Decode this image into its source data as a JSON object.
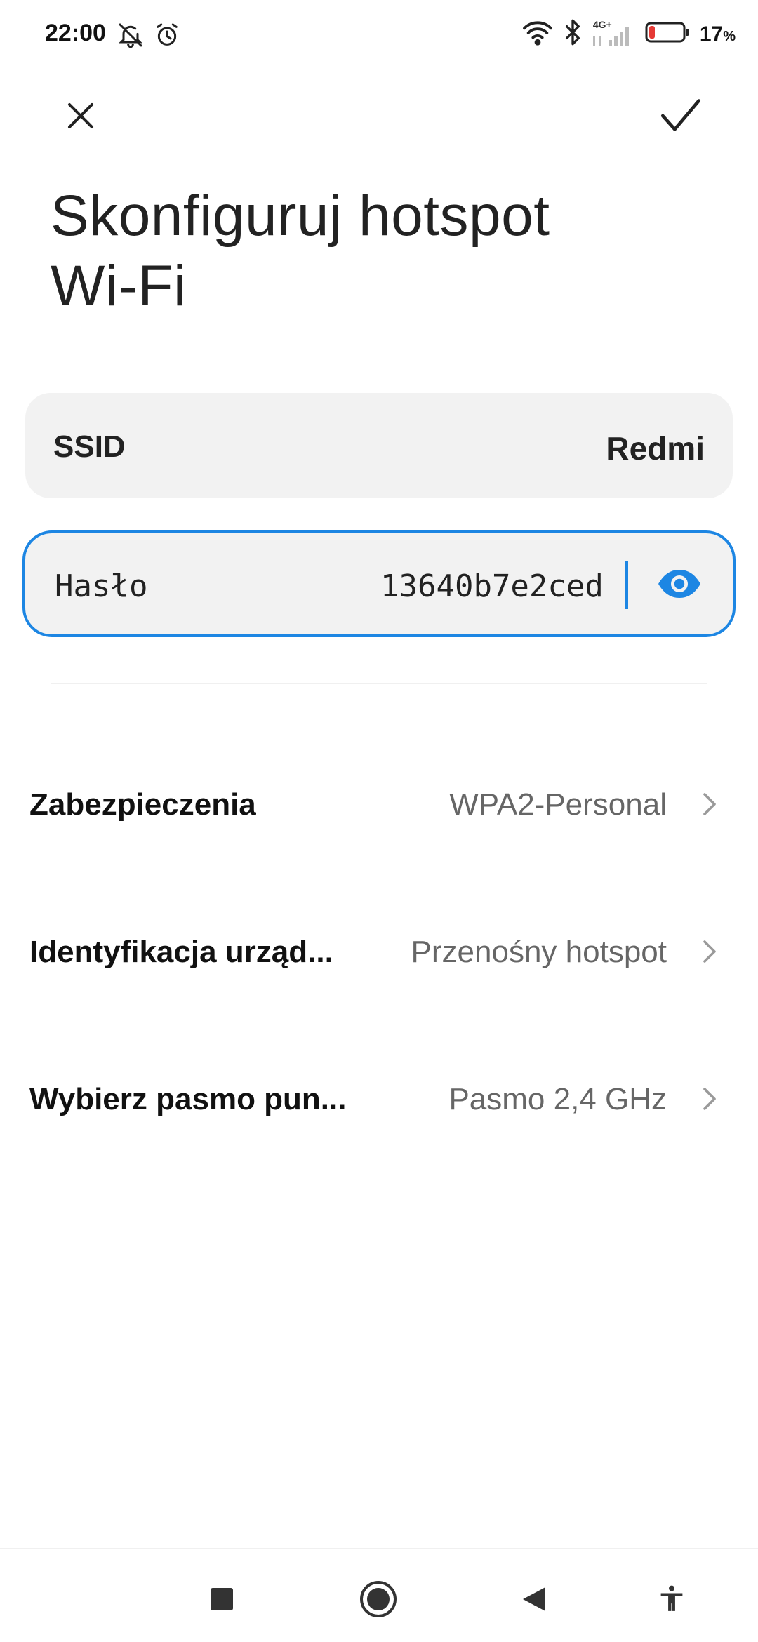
{
  "status_bar": {
    "time": "22:00",
    "battery_percent": "17",
    "battery_unit": "%",
    "network_label": "4G+",
    "battery_level": 0.17
  },
  "icons": {
    "bell_off": "bell-off-icon",
    "alarm": "alarm-icon",
    "wifi": "wifi-icon",
    "bluetooth": "bluetooth-icon",
    "signal": "signal-icon",
    "battery": "battery-icon",
    "close": "close-icon",
    "check": "check-icon",
    "eye": "eye-icon",
    "chevron": "chevron-right-icon"
  },
  "colors": {
    "accent": "#1d86e3",
    "battery_low": "#e53935",
    "card_bg": "#f2f2f2"
  },
  "title": {
    "line1": "Skonfiguruj hotspot",
    "line2": "Wi-Fi"
  },
  "ssid": {
    "label": "SSID",
    "value": "Redmi"
  },
  "password": {
    "label": "Hasło",
    "value": "13640b7e2ced"
  },
  "settings": [
    {
      "label": "Zabezpieczenia",
      "value": "WPA2-Personal"
    },
    {
      "label": "Identyfikacja urząd...",
      "value": "Przenośny hotspot"
    },
    {
      "label": "Wybierz pasmo pun...",
      "value": "Pasmo 2,4 GHz"
    }
  ]
}
